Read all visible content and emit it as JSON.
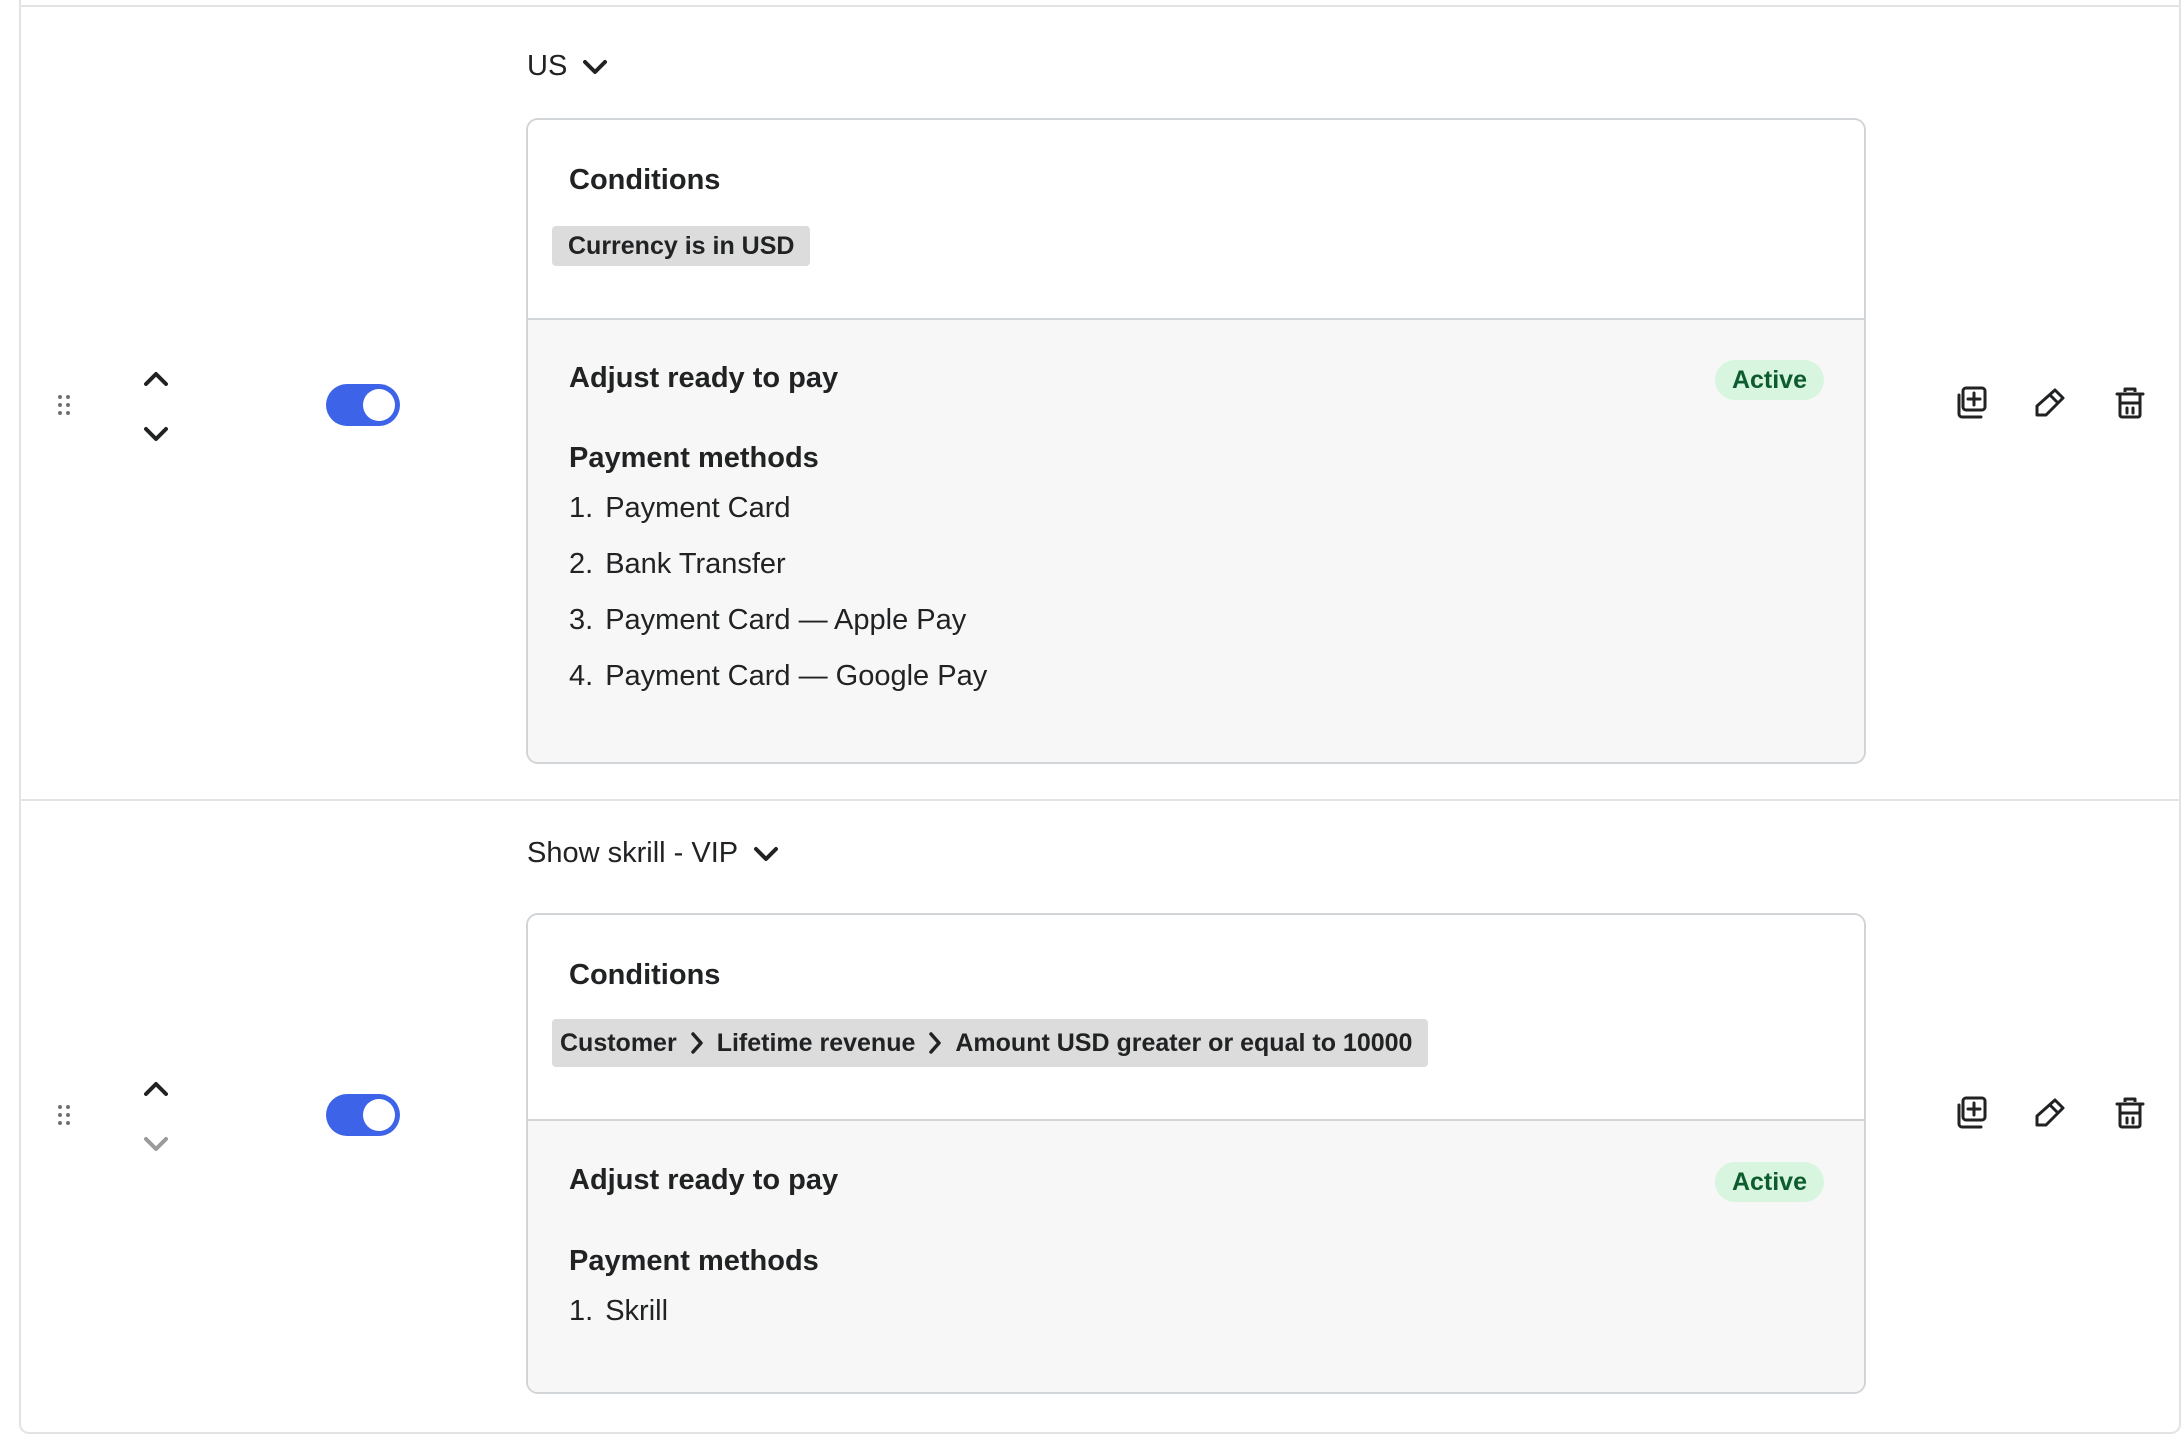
{
  "rules": [
    {
      "name": "US",
      "enabled": true,
      "conditions_heading": "Conditions",
      "condition_parts": [
        "Currency is in USD"
      ],
      "action_title": "Adjust ready to pay",
      "status": "Active",
      "payment_methods_heading": "Payment methods",
      "payment_methods": [
        {
          "num": "1.",
          "label": "Payment Card"
        },
        {
          "num": "2.",
          "label": "Bank Transfer"
        },
        {
          "num": "3.",
          "label": "Payment Card  — Apple Pay"
        },
        {
          "num": "4.",
          "label": "Payment Card  — Google Pay"
        }
      ]
    },
    {
      "name": "Show skrill - VIP",
      "enabled": true,
      "conditions_heading": "Conditions",
      "condition_parts": [
        "Customer",
        "Lifetime revenue",
        "Amount USD greater or equal to 10000"
      ],
      "action_title": "Adjust ready to pay",
      "status": "Active",
      "payment_methods_heading": "Payment methods",
      "payment_methods": [
        {
          "num": "1.",
          "label": "Skrill"
        }
      ]
    }
  ],
  "icons": {
    "drag": "drag-handle-icon",
    "up": "chevron-up-icon",
    "down": "chevron-down-icon",
    "duplicate": "duplicate-icon",
    "edit": "pencil-icon",
    "delete": "trash-icon"
  },
  "colors": {
    "toggle_on": "#3d64e8",
    "badge_bg": "#d7f5df",
    "badge_text": "#0d5c2e",
    "chip_bg": "#dcdcdc"
  }
}
